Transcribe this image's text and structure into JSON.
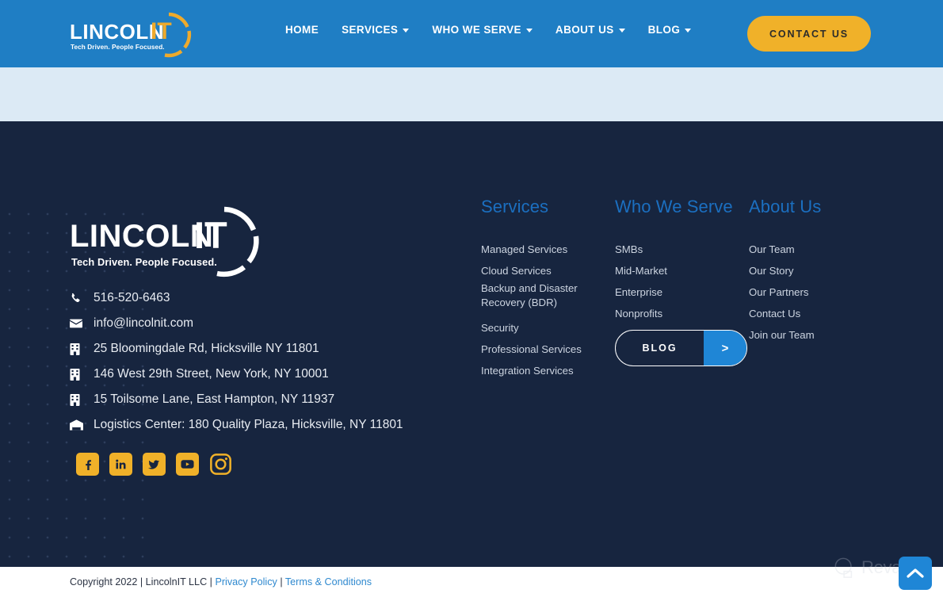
{
  "header": {
    "logo": {
      "word": "LINCOLN",
      "it": "IT",
      "tagline": "Tech Driven. People Focused."
    },
    "nav": [
      {
        "label": "HOME",
        "caret": false
      },
      {
        "label": "SERVICES",
        "caret": true
      },
      {
        "label": "WHO WE SERVE",
        "caret": true
      },
      {
        "label": "ABOUT US",
        "caret": true
      },
      {
        "label": "BLOG",
        "caret": true
      }
    ],
    "cta": "CONTACT US"
  },
  "footer": {
    "logo": {
      "word": "LINCOLN",
      "it": "IT",
      "tagline": "Tech Driven. People Focused."
    },
    "contact": [
      {
        "icon": "phone-icon",
        "text": "516-520-6463"
      },
      {
        "icon": "envelope-icon",
        "text": "info@lincolnit.com"
      },
      {
        "icon": "building-icon",
        "text": "25 Bloomingdale Rd, Hicksville NY 11801"
      },
      {
        "icon": "building-icon",
        "text": "146 West 29th Street, New York, NY 10001"
      },
      {
        "icon": "building-icon",
        "text": "15 Toilsome Lane, East Hampton, NY 11937"
      },
      {
        "icon": "warehouse-icon",
        "text": "Logistics Center: 180 Quality Plaza, Hicksville, NY 11801"
      }
    ],
    "socials": [
      {
        "name": "facebook-icon"
      },
      {
        "name": "linkedin-icon"
      },
      {
        "name": "twitter-icon"
      },
      {
        "name": "youtube-icon"
      },
      {
        "name": "instagram-icon"
      }
    ],
    "columns": {
      "services": {
        "heading": "Services",
        "links": [
          "Managed Services",
          "Cloud Services",
          "Backup and Disaster Recovery (BDR)",
          "Security",
          "Professional Services",
          "Integration Services"
        ]
      },
      "serve": {
        "heading": "Who We Serve",
        "links": [
          "SMBs",
          "Mid-Market",
          "Enterprise",
          "Nonprofits"
        ]
      },
      "about": {
        "heading": "About Us",
        "links": [
          "Our Team",
          "Our Story",
          "Our Partners",
          "Contact Us",
          "Join our Team"
        ]
      }
    },
    "blog_button": {
      "label": "BLOG",
      "arrow": ">"
    }
  },
  "copyright": {
    "text": "Copyright 2022 | LincolnIT LLC | ",
    "privacy": "Privacy Policy",
    "separator": " | ",
    "terms": "Terms & Conditions"
  },
  "watermark": {
    "text": "Revain"
  },
  "scroll_top": {
    "icon": "chevron-up-icon"
  },
  "colors": {
    "header_blue": "#1f7ec4",
    "band_blue": "#dceaf5",
    "footer_navy": "#17253f",
    "amber": "#f0b129",
    "heading_blue": "#1b6fc0",
    "link_blue": "#2f89cf",
    "accent_blue": "#1f86d6"
  }
}
